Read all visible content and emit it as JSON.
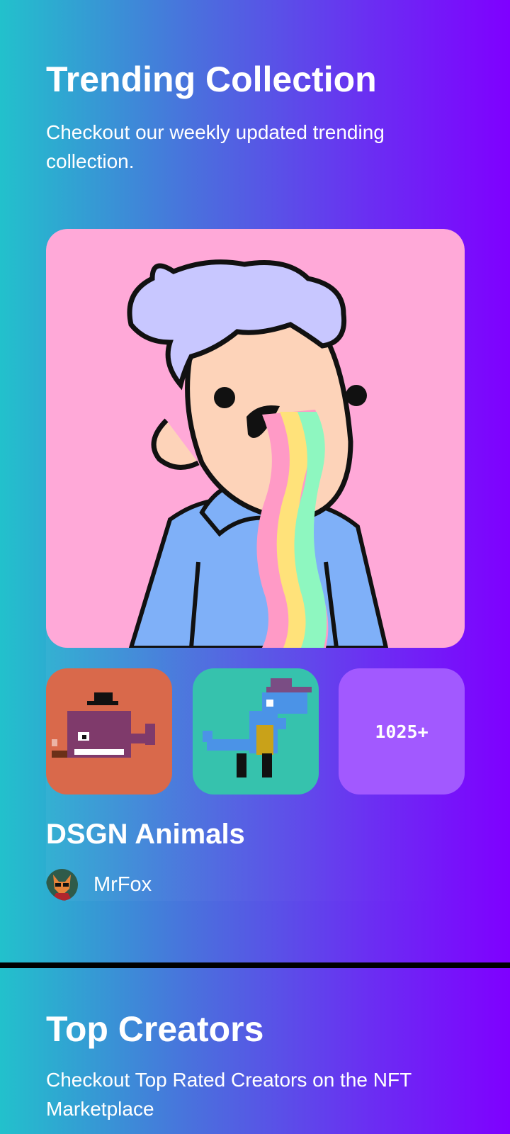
{
  "trending": {
    "title": "Trending Collection",
    "subtitle": "Checkout our weekly updated trending collection.",
    "collection": {
      "name": "DSGN Animals",
      "count_label": "1025+",
      "author": "MrFox",
      "thumbnails": [
        "rainbow-kid-art",
        "pipe-whale-art",
        "blue-dino-art"
      ]
    }
  },
  "creators": {
    "title": "Top Creators",
    "subtitle": "Checkout Top Rated Creators on the NFT Marketplace"
  }
}
